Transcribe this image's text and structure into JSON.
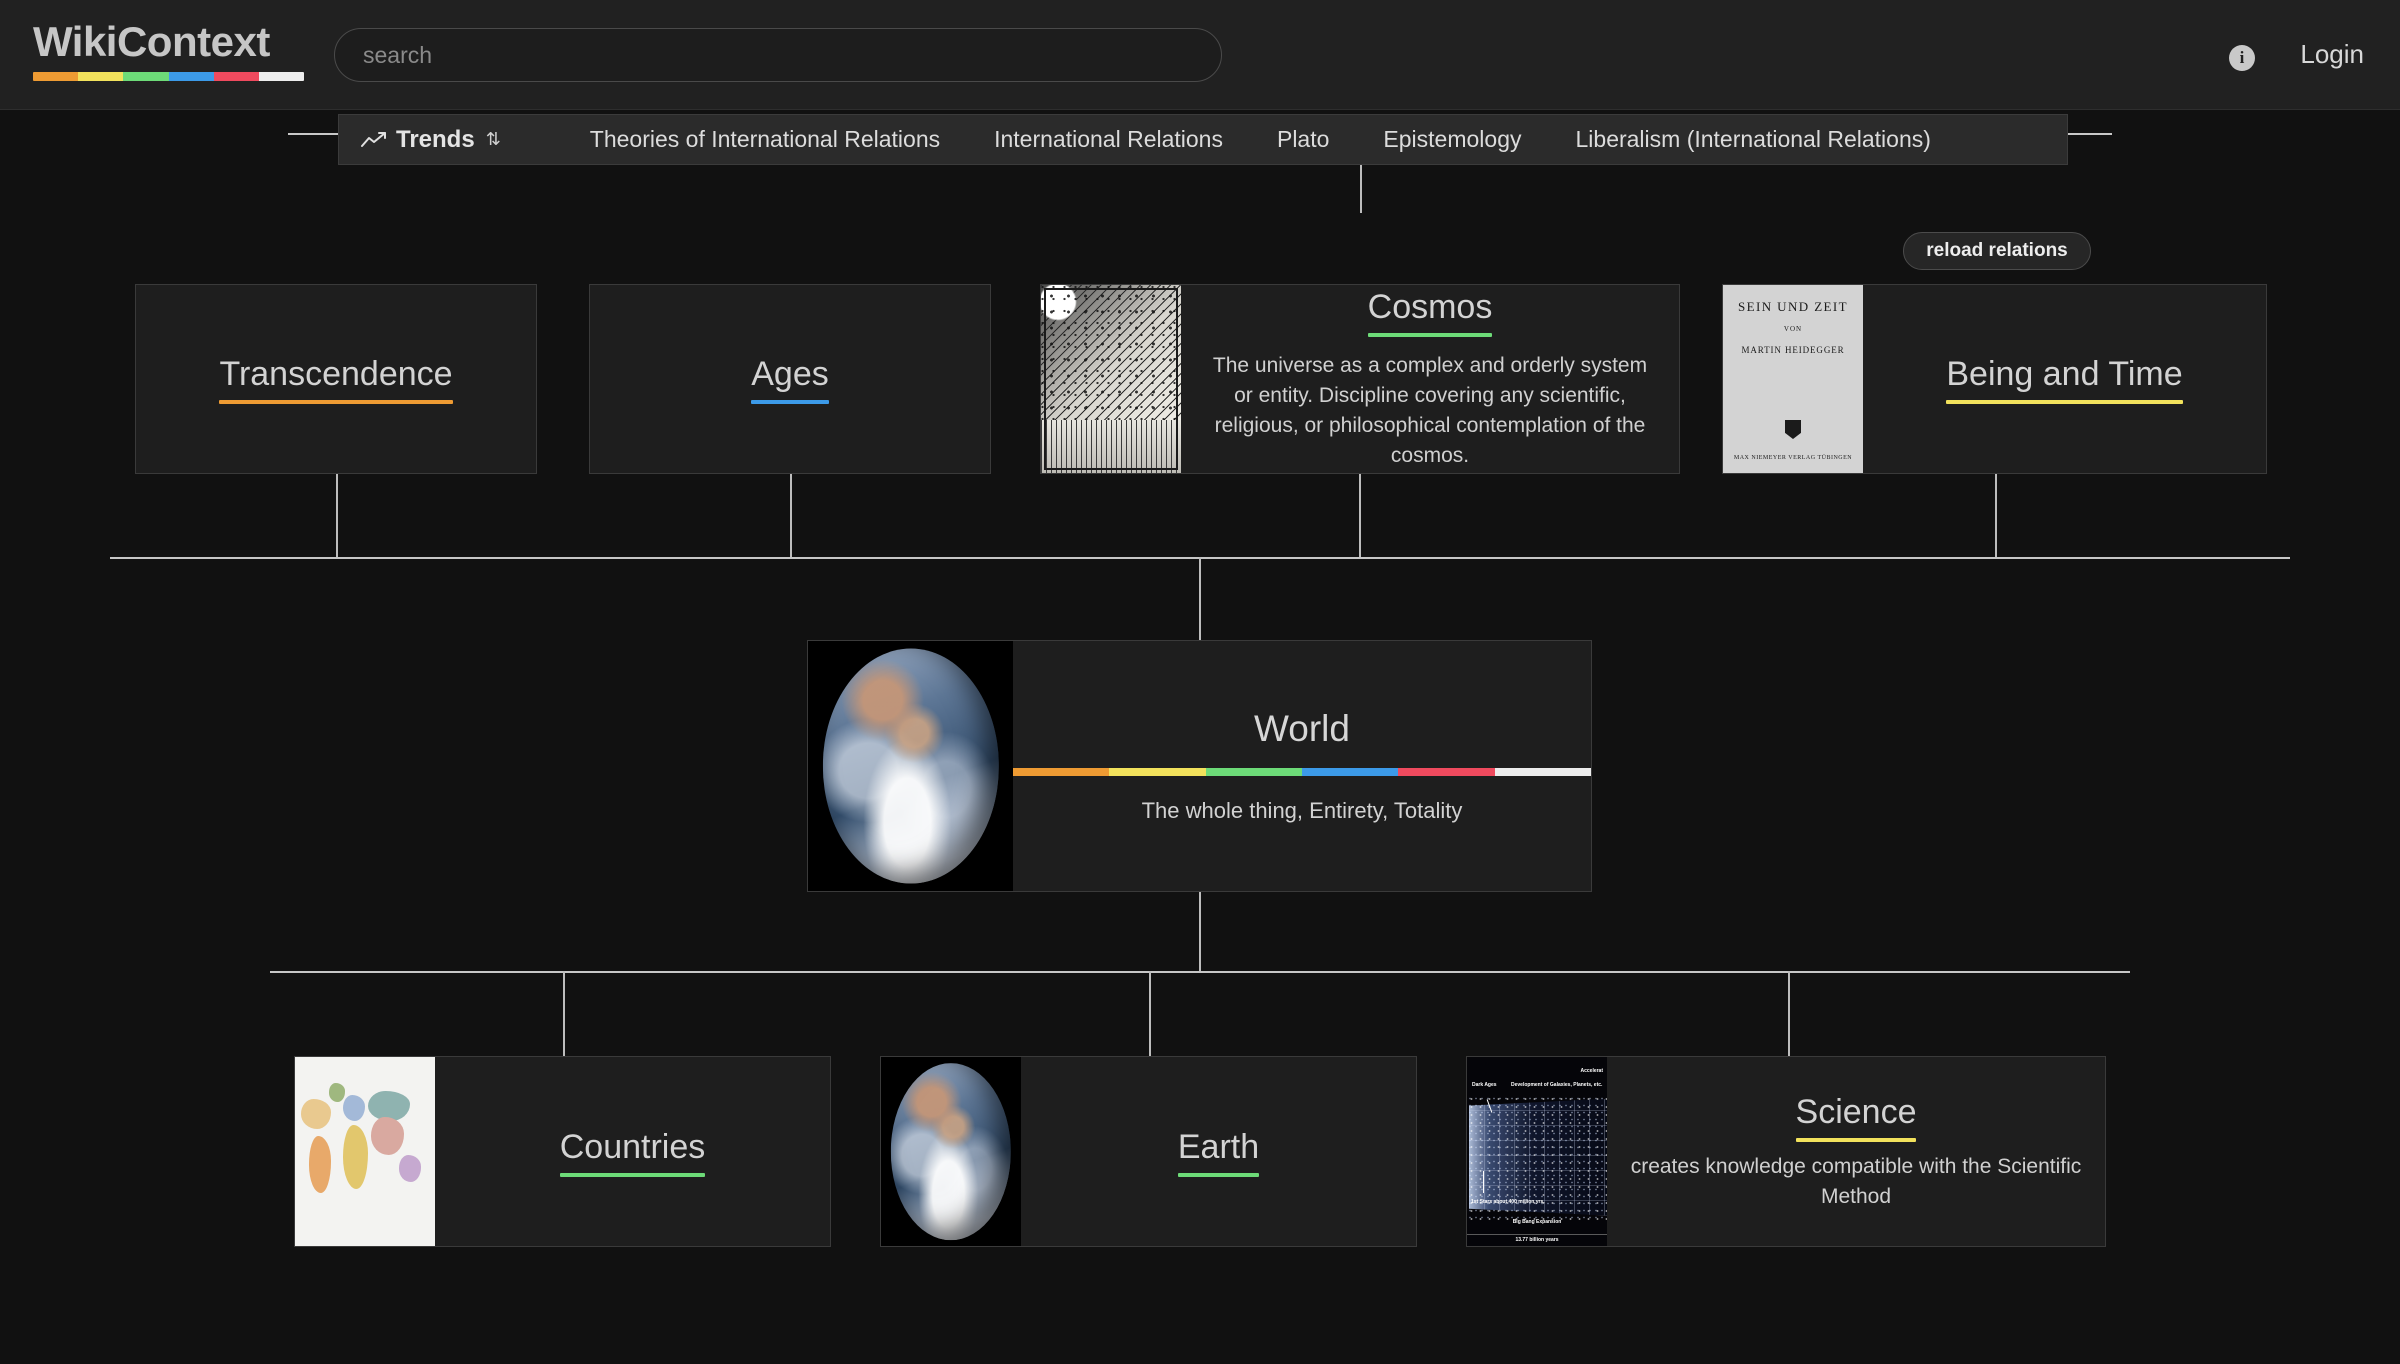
{
  "brand": {
    "name": "WikiContext",
    "bar_colors": [
      "#ee9b33",
      "#f2e25c",
      "#6ddb78",
      "#3c9ae8",
      "#ef4a5e",
      "#ededed"
    ]
  },
  "search": {
    "placeholder": "search",
    "value": ""
  },
  "header": {
    "info_label": "i",
    "login_label": "Login"
  },
  "trends": {
    "label": "Trends",
    "sort_glyph": "⇅",
    "items": [
      "Theories of International Relations",
      "International Relations",
      "Plato",
      "Epistemology",
      "Liberalism (International Relations)"
    ]
  },
  "actions": {
    "reload_label": "reload relations"
  },
  "graph": {
    "parents": [
      {
        "title": "Transcendence",
        "description": "",
        "accent": "#ee9b33",
        "thumb": "none"
      },
      {
        "title": "Ages",
        "description": "",
        "accent": "#3c9ae8",
        "thumb": "none"
      },
      {
        "title": "Cosmos",
        "description": "The universe as a complex and orderly system or entity. Discipline covering any scientific, religious, or philosophical contemplation of the cosmos.",
        "accent": "#6ddb78",
        "thumb": "cosmos-engraving-image"
      },
      {
        "title": "Being and Time",
        "description": "",
        "accent": "#f2e25c",
        "thumb": "book-cover-image"
      }
    ],
    "center": {
      "title": "World",
      "description": "The whole thing, Entirety, Totality",
      "bar_colors": [
        "#ee9b33",
        "#f2e25c",
        "#6ddb78",
        "#3c9ae8",
        "#ef4a5e",
        "#ededed"
      ],
      "thumb": "earth-photo-image"
    },
    "children": [
      {
        "title": "Countries",
        "description": "",
        "accent": "#6ddb78",
        "thumb": "world-map-image"
      },
      {
        "title": "Earth",
        "description": "",
        "accent": "#6ddb78",
        "thumb": "earth-photo-image"
      },
      {
        "title": "Science",
        "description": "creates knowledge compatible with the Scientific Method",
        "accent": "#f2e25c",
        "thumb": "big-bang-timeline-image"
      }
    ]
  },
  "thumbnails": {
    "book_cover": {
      "title": "SEIN UND ZEIT",
      "byline": "VON",
      "author": "MARTIN HEIDEGGER",
      "publisher": "MAX NIEMEYER VERLAG TÜBINGEN"
    },
    "big_bang": {
      "label_accelerating": "Accelerat",
      "label_dark_ages": "Dark Ages",
      "label_development": "Development of Galaxies, Planets, etc.",
      "label_first_stars": "1st Stars about 400 million yrs.",
      "label_expansion": "Big Bang Expansion",
      "label_age": "13.77 billion years"
    }
  }
}
